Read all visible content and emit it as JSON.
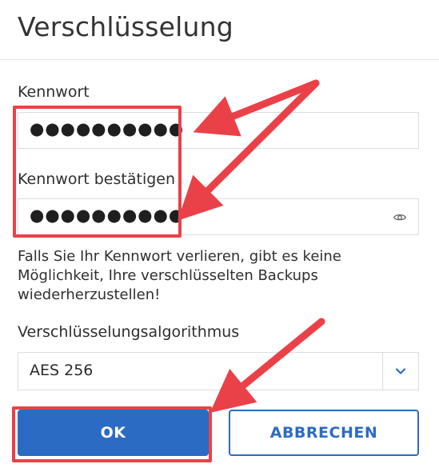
{
  "dialog": {
    "title": "Verschlüsselung",
    "password_label": "Kennwort",
    "password_value": "●●●●●●●●●●",
    "confirm_label": "Kennwort bestätigen",
    "confirm_value": "●●●●●●●●●●",
    "hint": "Falls Sie Ihr Kennwort verlieren, gibt es keine Möglichkeit, Ihre verschlüsselten Backups wiederherzustellen!",
    "algorithm_label": "Verschlüsselungsalgorithmus",
    "algorithm_value": "AES 256",
    "ok_label": "OK",
    "cancel_label": "ABBRECHEN"
  },
  "colors": {
    "accent": "#2c6bc4",
    "annotation": "#ea4148"
  },
  "icons": {
    "reveal": "eye-icon",
    "dropdown": "chevron-down-icon"
  }
}
